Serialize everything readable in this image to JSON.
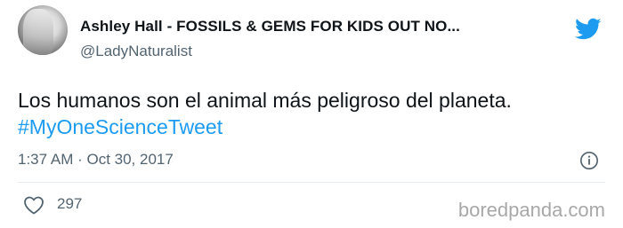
{
  "tweet": {
    "display_name": "Ashley Hall - FOSSILS & GEMS FOR KIDS OUT NO...",
    "handle": "@LadyNaturalist",
    "text": "Los humanos son el animal más peligroso del planeta.",
    "hashtag": "#MyOneScienceTweet",
    "timestamp": "1:37 AM · Oct 30, 2017",
    "like_count": "297"
  },
  "icons": {
    "brand": "twitter-bird-icon",
    "info": "info-icon",
    "like": "heart-icon"
  },
  "colors": {
    "brand": "#1d9bf0",
    "hashtag": "#1d9bf0",
    "secondary_text": "#536471"
  },
  "watermark": "boredpanda.com"
}
